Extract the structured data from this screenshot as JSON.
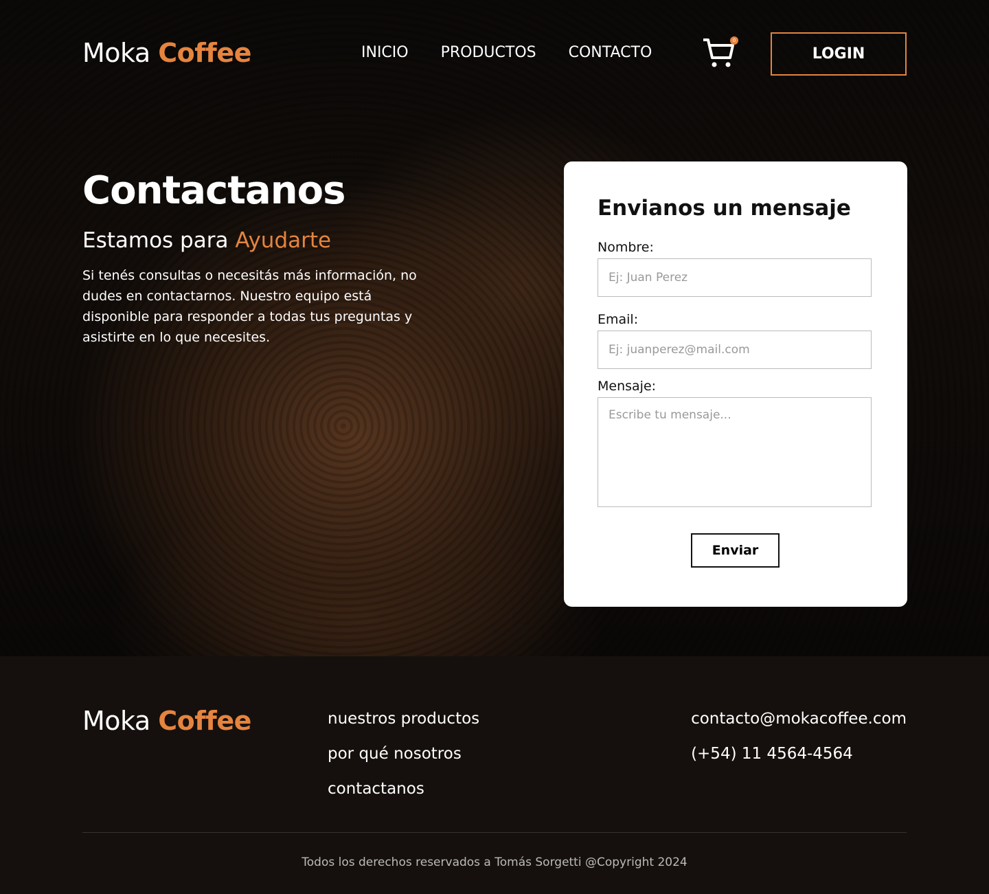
{
  "brand": {
    "name": "Moka",
    "accent": "Coffee",
    "accent_color": "#e5843f"
  },
  "nav": {
    "items": [
      "INICIO",
      "PRODUCTOS",
      "CONTACTO"
    ],
    "cart_count": "0",
    "login": "LOGIN"
  },
  "hero": {
    "title": "Contactanos",
    "subtitle_prefix": "Estamos para",
    "subtitle_accent": "Ayudarte",
    "text": "Si tenés consultas o necesitás más información, no dudes en contactarnos. Nuestro equipo está disponible para responder a todas tus preguntas y asistirte en lo que necesites."
  },
  "form": {
    "title": "Envianos un mensaje",
    "name_label": "Nombre:",
    "name_placeholder": "Ej: Juan Perez",
    "email_label": "Email:",
    "email_placeholder": "Ej: juanperez@mail.com",
    "message_label": "Mensaje:",
    "message_placeholder": "Escribe tu mensaje...",
    "submit": "Enviar"
  },
  "footer": {
    "links": [
      "nuestros productos",
      "por qué nosotros",
      "contactanos"
    ],
    "email": "contacto@mokacoffee.com",
    "phone": "(+54) 11 4564-4564",
    "copyright": "Todos los derechos reservados a Tomás Sorgetti @Copyright 2024"
  }
}
